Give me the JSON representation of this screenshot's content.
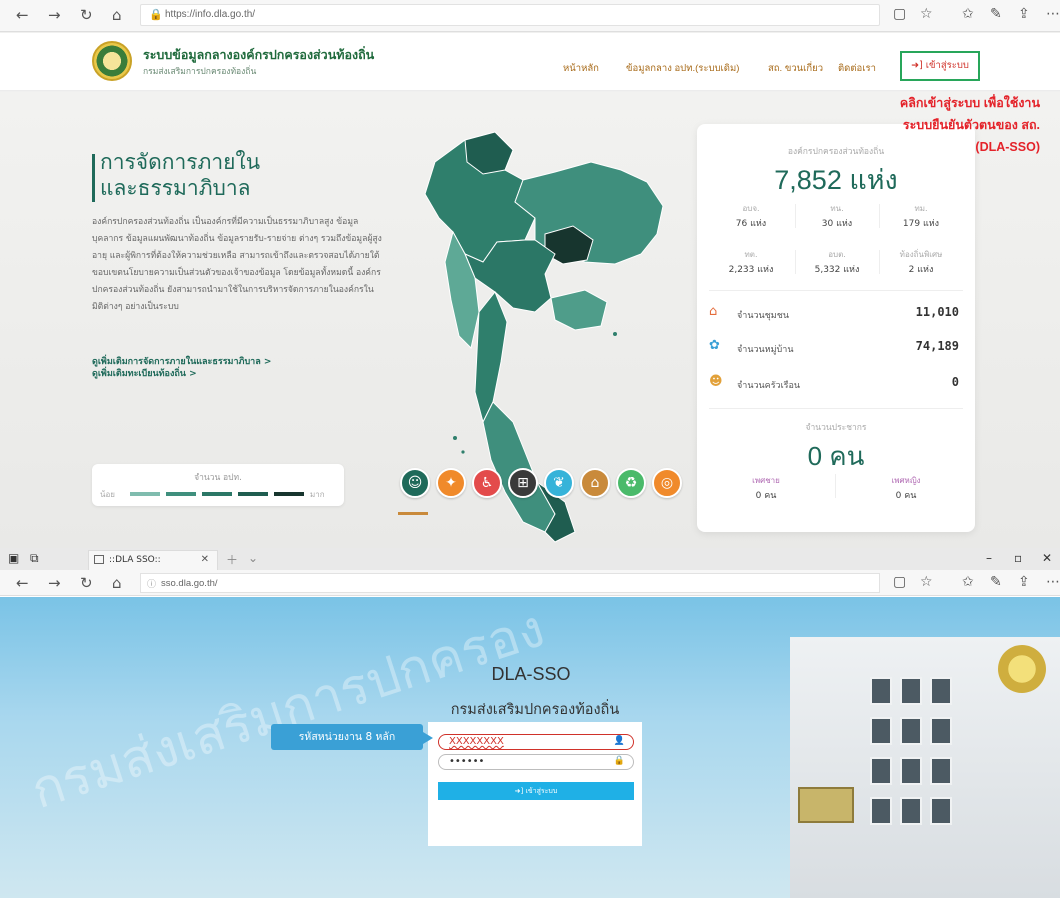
{
  "top_browser": {
    "url": "https://info.dla.go.th/",
    "site": {
      "name": "ระบบข้อมูลกลางองค์กรปกครองส่วนท้องถิ่น",
      "subtitle": "กรมส่งเสริมการปกครองท้องถิ่น"
    },
    "menu": {
      "items": [
        "หน้าหลัก",
        "ข้อมูลกลาง อปท.(ระบบเดิม)",
        "สถ. ขวนเกี่ยว",
        "ติดต่อเรา"
      ],
      "login_label": "เข้าสู่ระบบ"
    },
    "hero": {
      "title_line1": "การจัดการภายใน",
      "title_line2": "และธรรมาภิบาล",
      "body": "องค์กรปกครองส่วนท้องถิ่น เป็นองค์กรที่มีความเป็นธรรมาภิบาลสูง ข้อมูลบุคลากร ข้อมูลแผนพัฒนาท้องถิ่น ข้อมูลรายรับ-รายจ่าย ต่างๆ รวมถึงข้อมูลผู้สูงอายุ และผู้พิการที่ต้องให้ความช่วยเหลือ สามารถเข้าถึงและตรวจสอบได้ภายใต้ขอบเขตนโยบายความเป็นส่วนตัวของเจ้าของข้อมูล โดยข้อมูลทั้งหมดนี้ องค์กรปกครองส่วนท้องถิ่น ยังสามารถนำมาใช้ในการบริหารจัดการภายในองค์กรในมิติต่างๆ อย่างเป็นระบบ",
      "link1": "ดูเพิ่มเติมการจัดการภายในและธรรมาภิบาล >",
      "link2": "ดูเพิ่มเติมทะเบียนท้องถิ่น >"
    },
    "legend": {
      "title": "จำนวน อปท.",
      "low": "น้อย",
      "high": "มาก"
    },
    "stats": {
      "label": "องค์กรปกครองส่วนท้องถิ่น",
      "total": "7,852 แห่ง",
      "grid": [
        {
          "label": "อบจ.",
          "value": "76 แห่ง"
        },
        {
          "label": "ทน.",
          "value": "30 แห่ง"
        },
        {
          "label": "ทม.",
          "value": "179 แห่ง"
        },
        {
          "label": "ทต.",
          "value": "2,233 แห่ง"
        },
        {
          "label": "อบต.",
          "value": "5,332 แห่ง"
        },
        {
          "label": "ท้องถิ่นพิเศษ",
          "value": "2 แห่ง"
        }
      ],
      "rows": [
        {
          "label": "จำนวนชุมชน",
          "value": "11,010",
          "icon": "community-icon"
        },
        {
          "label": "จำนวนหมู่บ้าน",
          "value": "74,189",
          "icon": "village-icon"
        },
        {
          "label": "จำนวนครัวเรือน",
          "value": "0",
          "icon": "household-icon"
        }
      ],
      "population_label": "จำนวนประชากร",
      "population": "0 คน",
      "male_label": "เพศชาย",
      "male_value": "0 คน",
      "female_label": "เพศหญิง",
      "female_value": "0 คน"
    },
    "annotation": {
      "line1": "คลิกเข้าสู่ระบบ เพื่อใช้งาน",
      "line2": "ระบบยืนยันตัวตนของ สถ.",
      "line3": "(DLA-SSO)"
    },
    "colors": {
      "primary": "#1f6a5a",
      "annotation": "#e4232a",
      "login_border": "#28a65a"
    }
  },
  "bottom_browser": {
    "tab_title": "::DLA SSO::",
    "url": "sso.dla.go.th/",
    "watermark": "กรมส่งเสริมการปกครอง",
    "title": "DLA-SSO",
    "subtitle": "กรมส่งเสริมปกครองท้องถิ่น",
    "username": "XXXXXXXX",
    "password": "••••••",
    "submit_label": "เข้าสู่ระบบ",
    "callout": "รหัสหน่วยงาน 8 หลัก",
    "colors": {
      "submit": "#1fb0e6",
      "callout": "#3aa0d6"
    }
  }
}
